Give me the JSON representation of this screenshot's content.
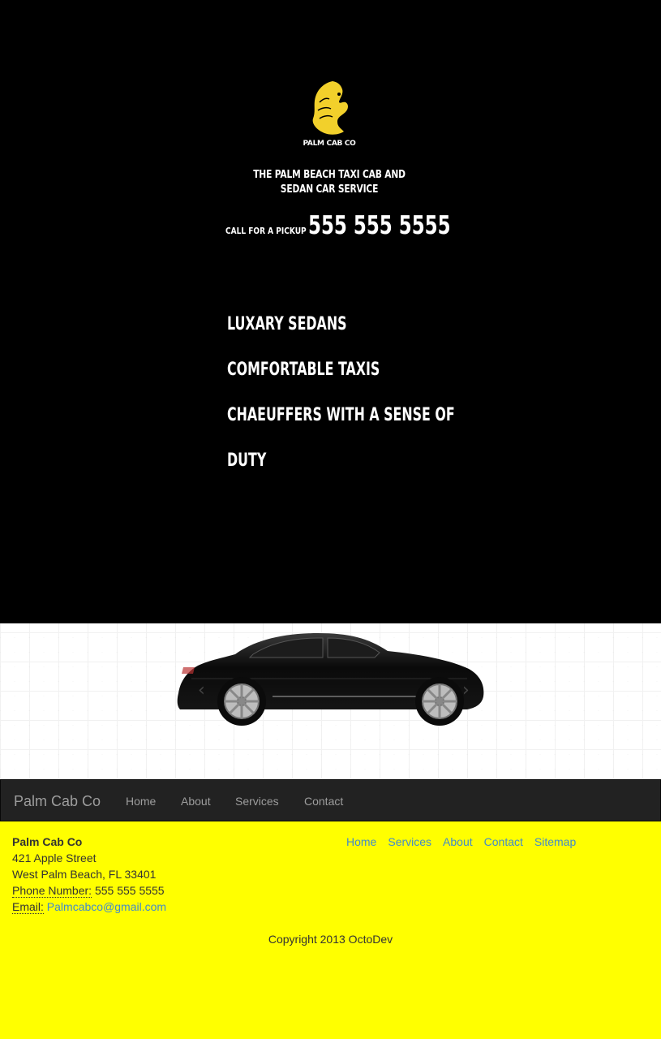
{
  "hero": {
    "logo_text": "PALM CAB CO",
    "tagline": "THE PALM BEACH TAXI CAB AND SEDAN CAR SERVICE",
    "call_label": "CALL FOR A PICKUP",
    "phone": "555 555 5555",
    "features": [
      "LUXARY SEDANS",
      "COMFORTABLE TAXIS",
      "CHAEUFFERS WITH A SENSE OF",
      "DUTY"
    ]
  },
  "carousel": {
    "prev_icon": "chevron-left-icon",
    "next_icon": "chevron-right-icon",
    "prev_glyph": "‹",
    "next_glyph": "›"
  },
  "navbar": {
    "brand": "Palm Cab Co",
    "links": [
      "Home",
      "About",
      "Services",
      "Contact"
    ]
  },
  "footer": {
    "org": "Palm Cab Co",
    "street": "421 Apple Street",
    "city": "West Palm Beach, FL 33401",
    "phone_label": "Phone Number:",
    "phone": "555 555 5555",
    "email_label": "Email:",
    "email": "Palmcabco@gmail.com",
    "links": [
      "Home",
      "Services",
      "About",
      "Contact",
      "Sitemap"
    ],
    "copyright": "Copyright 2013 OctoDev"
  },
  "colors": {
    "hero_bg": "#000000",
    "footer_bg": "#ffff00",
    "navbar_bg": "#222222",
    "link": "#428bca",
    "logo_gold": "#f2d02b"
  }
}
